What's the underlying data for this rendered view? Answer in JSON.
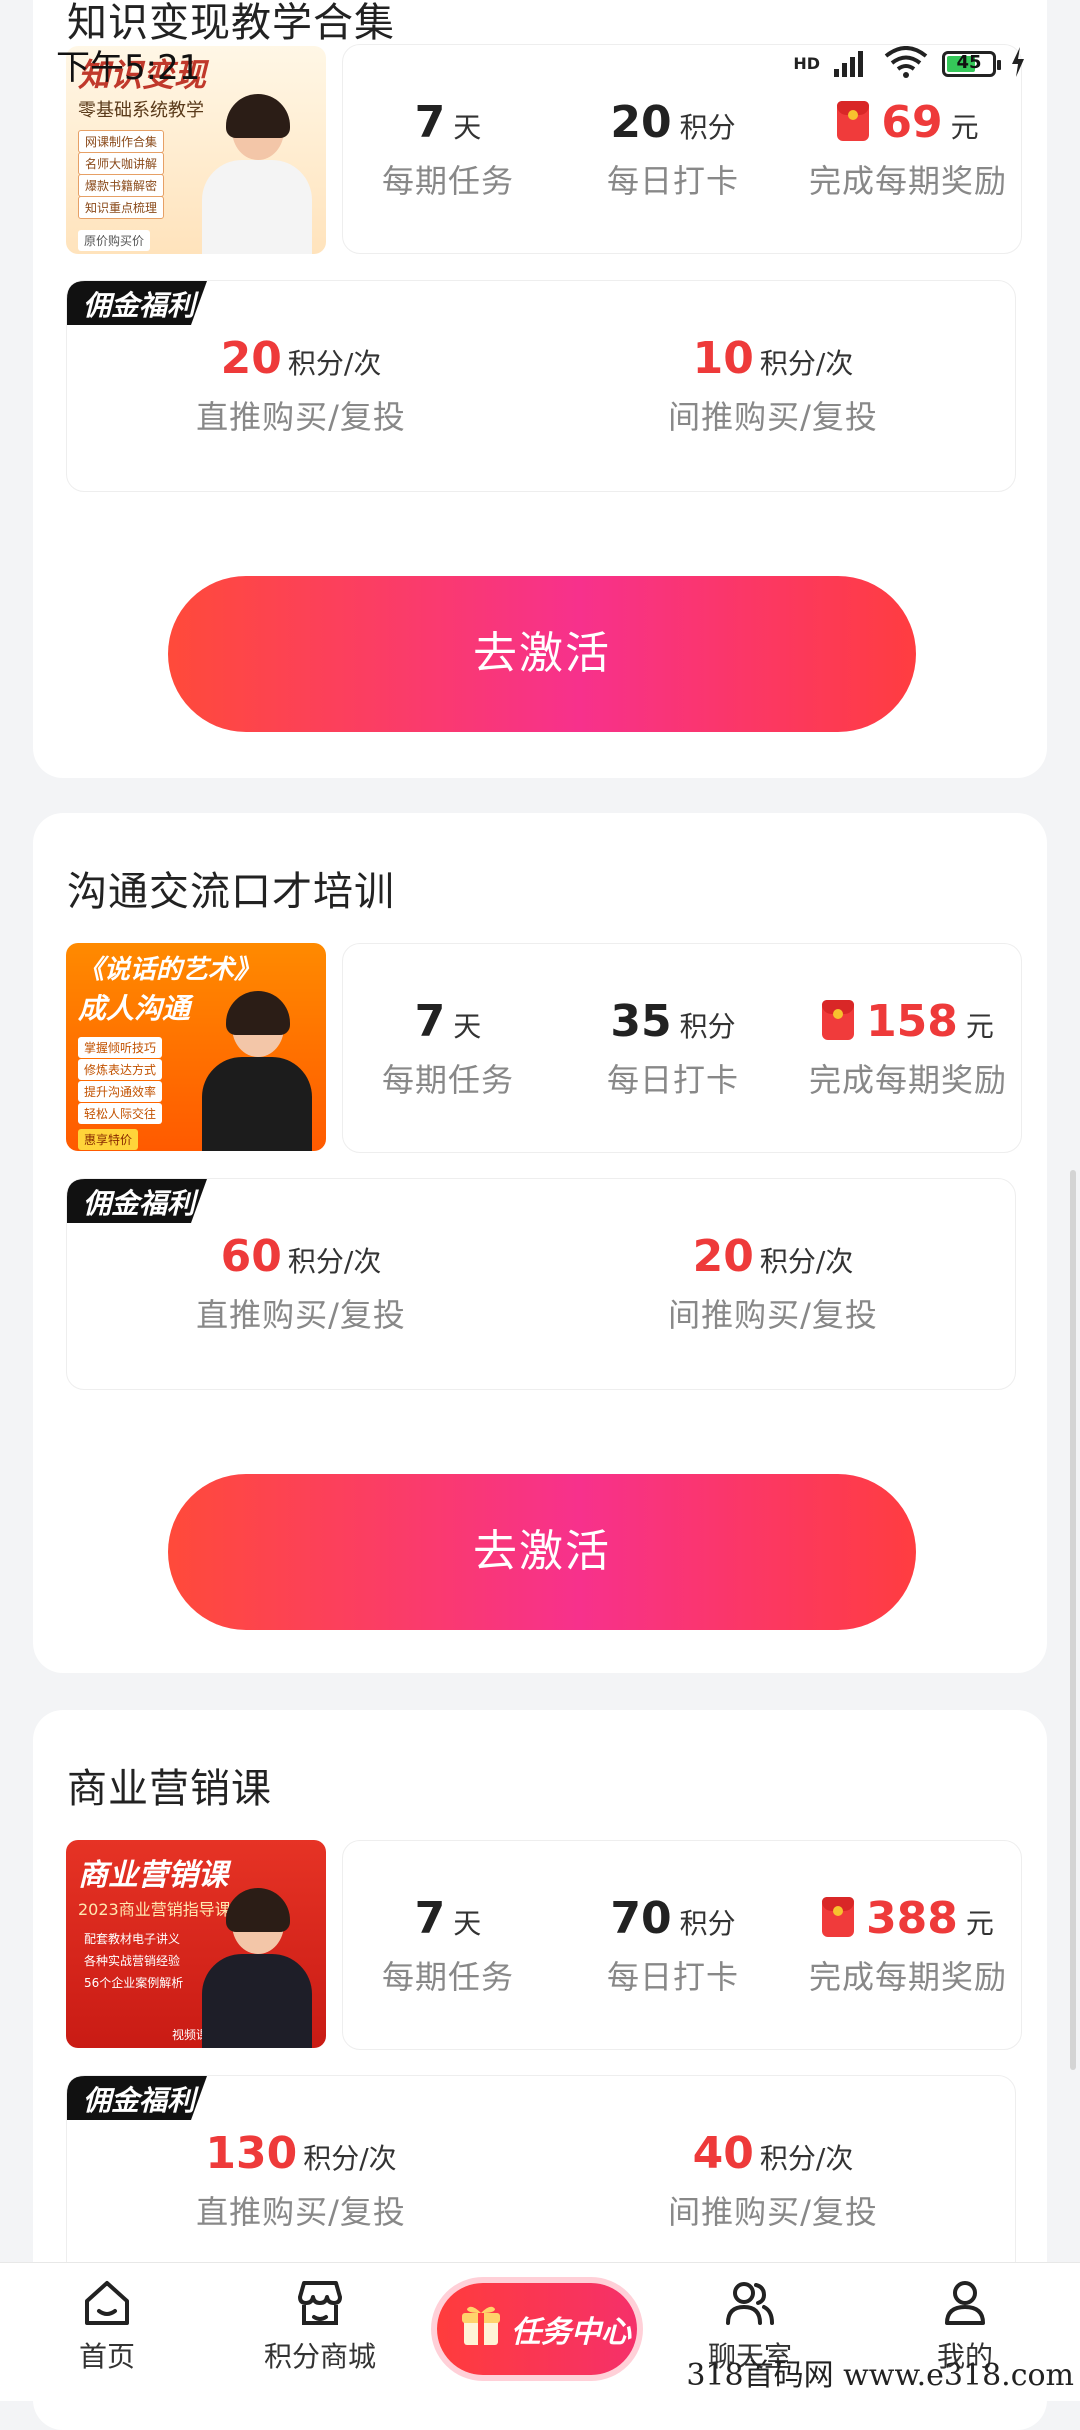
{
  "status_bar": {
    "time": "下午5:21",
    "hd": "HD",
    "battery": "45"
  },
  "courses": [
    {
      "title": "知识变现教学合集",
      "thumb": {
        "title": "知识变现",
        "subtitle": "零基础系统教学",
        "bullets": [
          "网课制作合集",
          "名师大咖讲解",
          "爆款书籍解密",
          "知识重点梳理"
        ],
        "footer": "原价购买价"
      },
      "period_days": "7",
      "period_unit": "天",
      "period_label": "每期任务",
      "checkin_points": "20",
      "checkin_unit": "积分",
      "checkin_label": "每日打卡",
      "reward_amount": "69",
      "reward_unit": "元",
      "reward_label": "完成每期奖励",
      "commission_tag": "佣金福利",
      "direct_points": "20",
      "direct_unit": "积分/次",
      "direct_label": "直推购买/复投",
      "indirect_points": "10",
      "indirect_unit": "积分/次",
      "indirect_label": "间推购买/复投",
      "button": "去激活"
    },
    {
      "title": "沟通交流口才培训",
      "thumb": {
        "title": "《说话的艺术》",
        "subtitle": "成人沟通",
        "bullets": [
          "掌握倾听技巧",
          "修炼表达方式",
          "提升沟通效率",
          "轻松人际交往"
        ],
        "footer": "惠享特价"
      },
      "period_days": "7",
      "period_unit": "天",
      "period_label": "每期任务",
      "checkin_points": "35",
      "checkin_unit": "积分",
      "checkin_label": "每日打卡",
      "reward_amount": "158",
      "reward_unit": "元",
      "reward_label": "完成每期奖励",
      "commission_tag": "佣金福利",
      "direct_points": "60",
      "direct_unit": "积分/次",
      "direct_label": "直推购买/复投",
      "indirect_points": "20",
      "indirect_unit": "积分/次",
      "indirect_label": "间推购买/复投",
      "button": "去激活"
    },
    {
      "title": "商业营销课",
      "thumb": {
        "title": "商业营销课",
        "subtitle": "2023商业营销指导课",
        "bullets": [
          "配套教材电子讲义",
          "各种实战营销经验",
          "56个企业案例解析"
        ],
        "footer": "视频课程+图文案例"
      },
      "period_days": "7",
      "period_unit": "天",
      "period_label": "每期任务",
      "checkin_points": "70",
      "checkin_unit": "积分",
      "checkin_label": "每日打卡",
      "reward_amount": "388",
      "reward_unit": "元",
      "reward_label": "完成每期奖励",
      "commission_tag": "佣金福利",
      "direct_points": "130",
      "direct_unit": "积分/次",
      "direct_label": "直推购买/复投",
      "indirect_points": "40",
      "indirect_unit": "积分/次",
      "indirect_label": "间推购买/复投"
    }
  ],
  "nav": {
    "home": "首页",
    "mall": "积分商城",
    "task_center": "任务中心",
    "chat": "聊天室",
    "mine": "我的"
  },
  "watermark": "318首码网  www.e318.com",
  "colors": {
    "accent_red": "#ee3a3a",
    "button_gradient_start": "#ff4a3a",
    "button_gradient_mid": "#f7318c"
  }
}
